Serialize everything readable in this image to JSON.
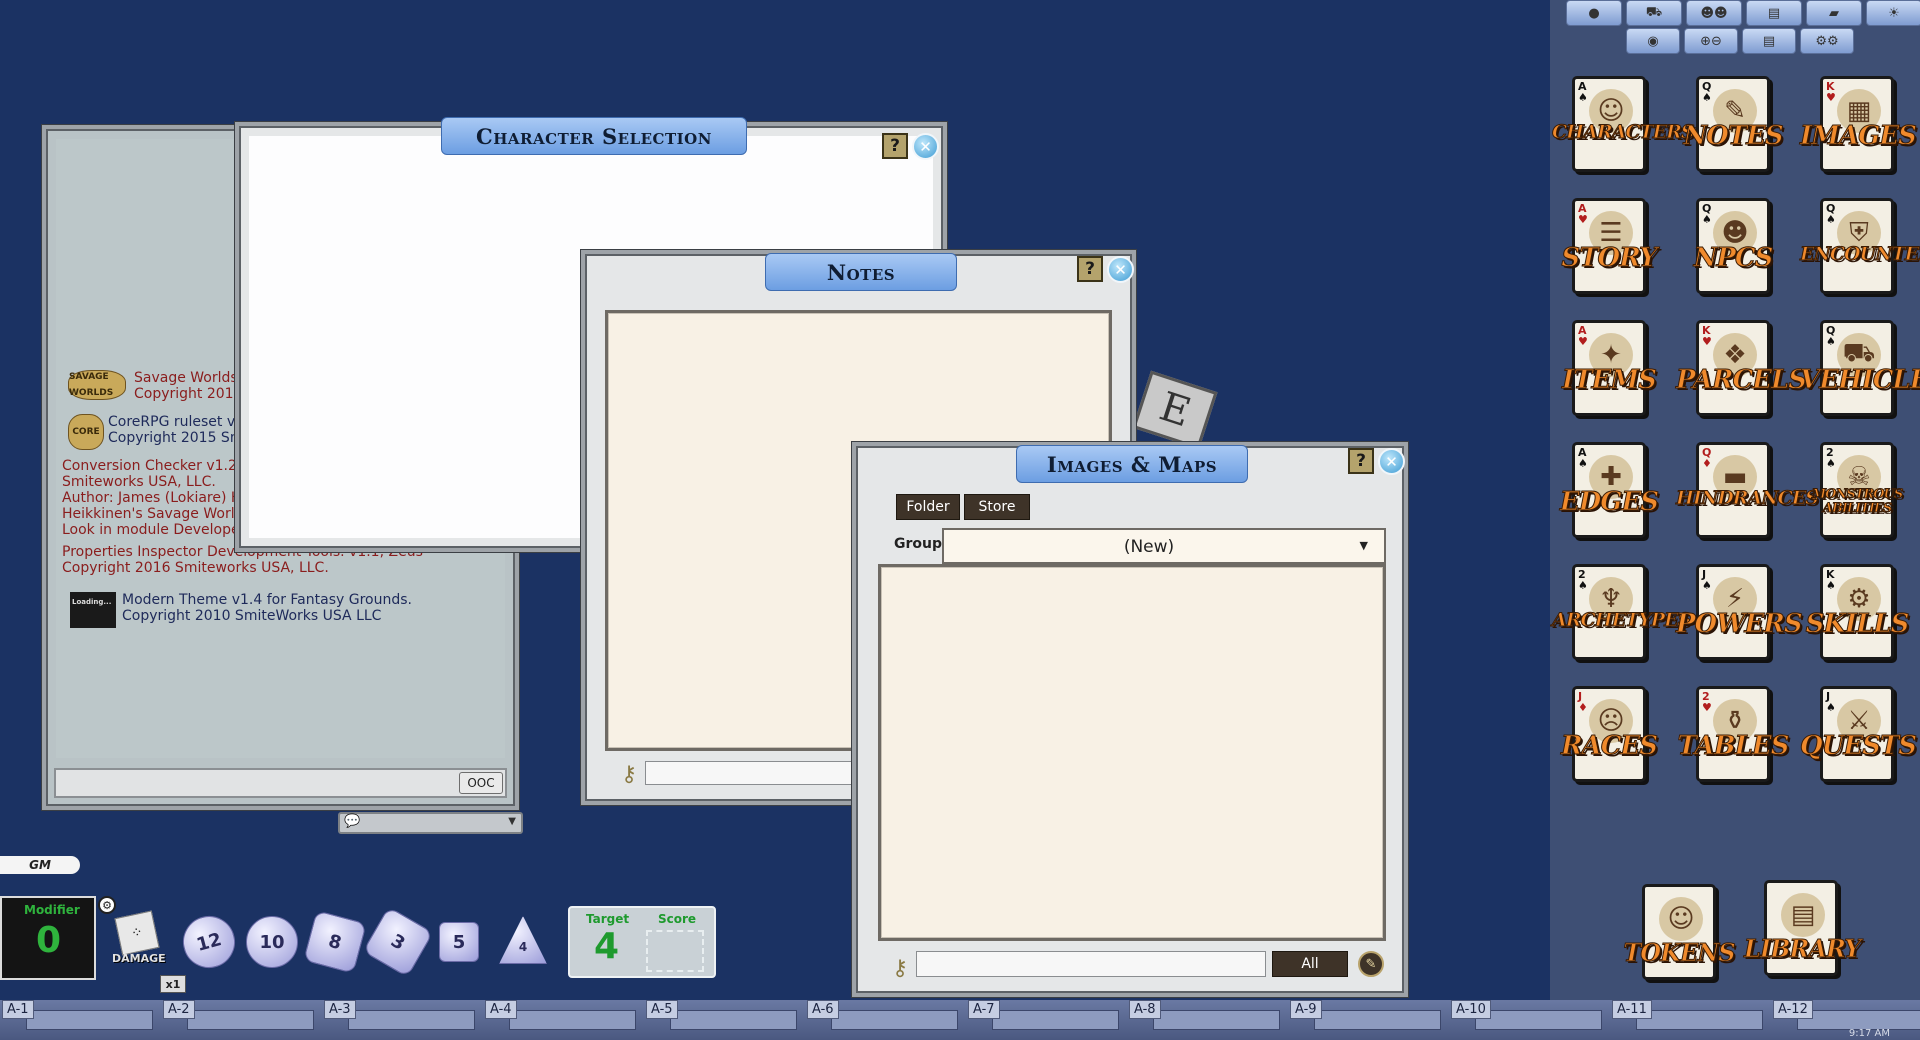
{
  "sidebar": {
    "cards": [
      {
        "label": "CHARACTERS",
        "rank": "A",
        "suit": "♠",
        "red": false,
        "icon": "☺"
      },
      {
        "label": "NOTES",
        "rank": "Q",
        "suit": "♠",
        "red": false,
        "icon": "✎"
      },
      {
        "label": "IMAGES",
        "rank": "K",
        "suit": "♥",
        "red": true,
        "icon": "▦"
      },
      {
        "label": "STORY",
        "rank": "A",
        "suit": "♥",
        "red": true,
        "icon": "☰"
      },
      {
        "label": "NPCS",
        "rank": "Q",
        "suit": "♠",
        "red": false,
        "icon": "☻"
      },
      {
        "label": "ENCOUNTERS",
        "rank": "Q",
        "suit": "♠",
        "red": false,
        "icon": "⛨"
      },
      {
        "label": "ITEMS",
        "rank": "A",
        "suit": "♥",
        "red": true,
        "icon": "✦"
      },
      {
        "label": "PARCELS",
        "rank": "K",
        "suit": "♥",
        "red": true,
        "icon": "❖"
      },
      {
        "label": "VEHICLES",
        "rank": "Q",
        "suit": "♠",
        "red": false,
        "icon": "⛟"
      },
      {
        "label": "EDGES",
        "rank": "A",
        "suit": "♠",
        "red": false,
        "icon": "✚"
      },
      {
        "label": "HINDRANCES",
        "rank": "Q",
        "suit": "♦",
        "red": true,
        "icon": "▬"
      },
      {
        "label": "MONSTROUS ABILITIES",
        "rank": "2",
        "suit": "♠",
        "red": false,
        "icon": "☠"
      },
      {
        "label": "ARCHETYPES",
        "rank": "2",
        "suit": "♠",
        "red": false,
        "icon": "♆"
      },
      {
        "label": "POWERS",
        "rank": "J",
        "suit": "♠",
        "red": false,
        "icon": "⚡"
      },
      {
        "label": "SKILLS",
        "rank": "K",
        "suit": "♠",
        "red": false,
        "icon": "⚙"
      },
      {
        "label": "RACES",
        "rank": "J",
        "suit": "♦",
        "red": true,
        "icon": "☹"
      },
      {
        "label": "TABLES",
        "rank": "2",
        "suit": "♥",
        "red": true,
        "icon": "⚱"
      },
      {
        "label": "QUESTS",
        "rank": "J",
        "suit": "♠",
        "red": false,
        "icon": "⚔"
      }
    ],
    "bottom_cards": [
      {
        "label": "TOKENS",
        "icon": "☺"
      },
      {
        "label": "LIBRARY",
        "icon": "▤"
      }
    ],
    "toolbar_row1": [
      "●",
      "⛟",
      "☻☻",
      "▤",
      "▰",
      "☀"
    ],
    "toolbar_row2": [
      "◉",
      "⊕⊖",
      "▤",
      "⚙⚙"
    ]
  },
  "chat": {
    "entries": [
      {
        "logo": "SAVAGE WORLDS",
        "text": "Savage Worlds ruleset v5.0.5 for Fantasy Grounds\nCopyright 2017 Pinnacle Entertainment Group"
      },
      {
        "logo": "CORE",
        "text": "CoreRPG ruleset v3.3.x for Fantasy Grounds\nCopyright 2015 Smiteworks USA, LLC"
      },
      {
        "text": "Conversion Checker v1.2.0 for FG V.3.x Copyright 2017\nSmiteworks USA, LLC.\nAuthor: James (Lokiare) Holloway (Inspired by Aki\nHeikkinen's Savage Worlds Enhanced Library extension).\nLook in module Developer Tools for instructions."
      },
      {
        "text": "Properties Inspector Development Tools. v1.1, Zeus\nCopyright 2016 Smiteworks USA, LLC."
      },
      {
        "logo": "Loading...",
        "text": "Modern Theme v1.4 for Fantasy Grounds.\nCopyright 2010 SmiteWorks USA LLC"
      }
    ],
    "ooc_label": "OOC",
    "identity": "GM"
  },
  "character_selection": {
    "title": "Character Selection",
    "help": "?"
  },
  "notes": {
    "title": "Notes",
    "help": "?"
  },
  "images": {
    "title": "Images & Maps",
    "help": "?",
    "tab_folder": "Folder",
    "tab_store": "Store",
    "group_label": "Group",
    "group_value": "(New)",
    "filter_all": "All"
  },
  "dice_bar": {
    "modifier_label": "Modifier",
    "modifier_value": "0",
    "damage_label": "DAMAGE",
    "multiplier": "x1",
    "dice": [
      "12",
      "10",
      "8",
      "3",
      "5",
      "4"
    ],
    "target_label": "Target",
    "target_value": "4",
    "score_label": "Score"
  },
  "hotkeys": [
    "A-1",
    "A-2",
    "A-3",
    "A-4",
    "A-5",
    "A-6",
    "A-7",
    "A-8",
    "A-9",
    "A-10",
    "A-11",
    "A-12"
  ],
  "clock": "9:17 AM",
  "colors": {
    "desktop": "#1b3263",
    "sidebar": "#3e4f74",
    "title_bar": "#6c9ee2",
    "parchment": "#f8f1e5",
    "card_label": "#f08a2c",
    "chat_text": "#8a1d1d",
    "target_green": "#1e9a2e"
  }
}
